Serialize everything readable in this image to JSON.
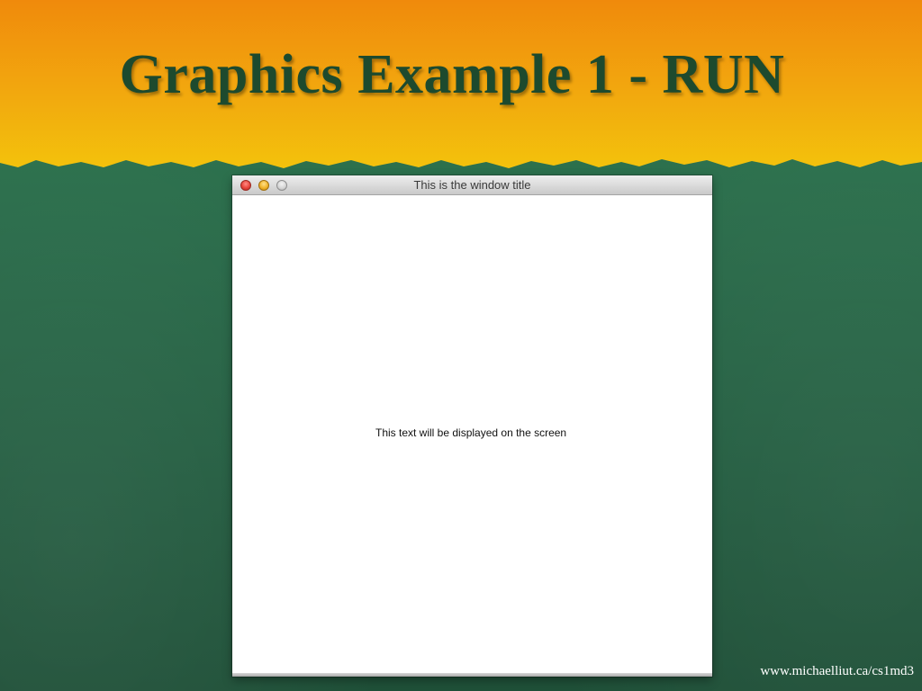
{
  "slide": {
    "title": "Graphics Example 1 - RUN",
    "footer_url": "www.michaelliut.ca/cs1md3"
  },
  "window": {
    "title": "This is the window title",
    "content_text": "This text will be displayed on the screen",
    "buttons": [
      "close-button",
      "minimize-button",
      "zoom-button"
    ]
  },
  "colors": {
    "banner_top": "#f08a0c",
    "banner_bottom": "#f3c20c",
    "background_green": "#2a6b4a",
    "title_text": "#1d4a2e",
    "footer_text": "#ffffff"
  }
}
